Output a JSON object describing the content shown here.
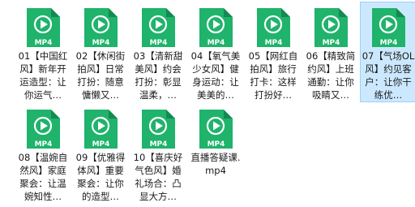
{
  "colors": {
    "icon_green": "#1fb36b",
    "icon_green_dark": "#148a50",
    "icon_label_text": "#ffffff",
    "selected_background": "#cce8ff",
    "selected_border": "#99d1ff"
  },
  "icon": {
    "name": "mp4-video-file-icon",
    "badge_text": "MP4"
  },
  "files": [
    {
      "name": "01【中国红风】新年开运造型：让你运气…",
      "selected": false
    },
    {
      "name": "02【休闲街拍风】日常打扮：随意慵懒又…",
      "selected": false
    },
    {
      "name": "03【清新甜美风】约会打扮：彰显温柔，…",
      "selected": false
    },
    {
      "name": "04【氧气美少女风】健身运动：让美美的…",
      "selected": false
    },
    {
      "name": "05【网红自拍风】旅行打卡：这样打扮好…",
      "selected": false
    },
    {
      "name": "06【精致简约风】上班通勤：让你吸睛又…",
      "selected": false
    },
    {
      "name": "07【气场OL风】约见客户：让你干练优…",
      "selected": true
    },
    {
      "name": "08【温婉自然风】家庭聚会：让温婉知性…",
      "selected": false
    },
    {
      "name": "09【优雅得体风】重要聚会：让你的造型…",
      "selected": false
    },
    {
      "name": "10【喜庆好气色风】婚礼场合：凸显大方…",
      "selected": false
    },
    {
      "name": "直播答疑课.mp4",
      "selected": false
    }
  ]
}
